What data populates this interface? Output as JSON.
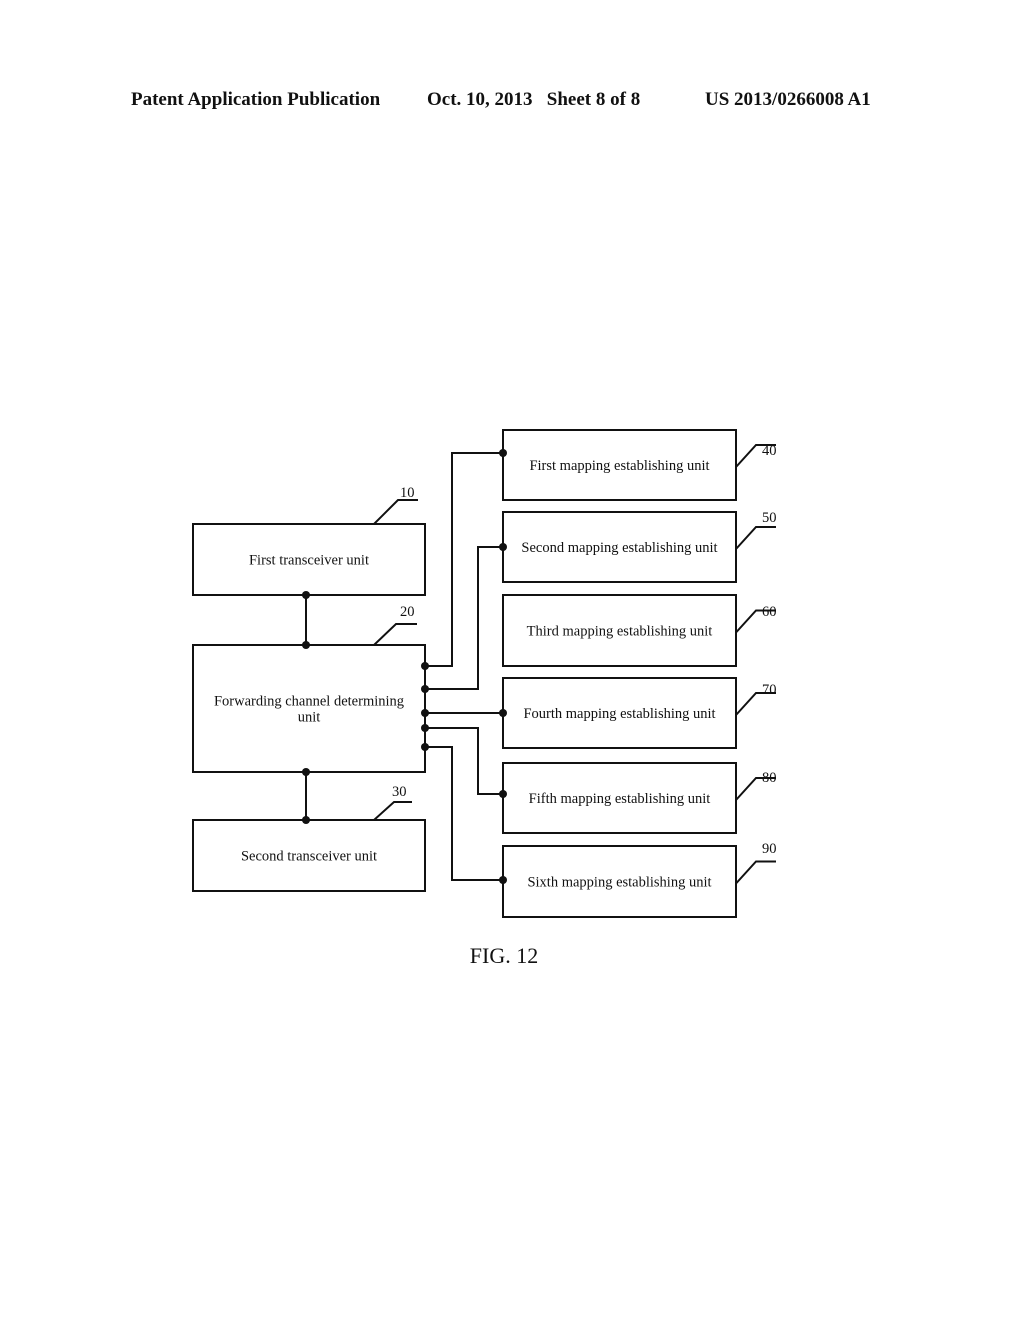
{
  "header": {
    "publication": "Patent Application Publication",
    "date_sheet": "Oct. 10, 2013   Sheet 8 of 8",
    "number": "US 2013/0266008 A1"
  },
  "figure": {
    "caption": "FIG. 12",
    "units": [
      {
        "id": "u10",
        "ref": "10",
        "label": [
          "First transceiver unit"
        ]
      },
      {
        "id": "u20",
        "ref": "20",
        "label": [
          "Forwarding channel determining",
          "unit"
        ]
      },
      {
        "id": "u30",
        "ref": "30",
        "label": [
          "Second transceiver unit"
        ]
      },
      {
        "id": "u40",
        "ref": "40",
        "label": [
          "First mapping establishing unit"
        ]
      },
      {
        "id": "u50",
        "ref": "50",
        "label": [
          "Second mapping establishing unit"
        ]
      },
      {
        "id": "u60",
        "ref": "60",
        "label": [
          "Third mapping establishing unit"
        ]
      },
      {
        "id": "u70",
        "ref": "70",
        "label": [
          "Fourth mapping establishing unit"
        ]
      },
      {
        "id": "u80",
        "ref": "80",
        "label": [
          "Fifth mapping establishing unit"
        ]
      },
      {
        "id": "u90",
        "ref": "90",
        "label": [
          "Sixth mapping establishing unit"
        ]
      }
    ],
    "connections": [
      {
        "from": "u10",
        "to": "u20"
      },
      {
        "from": "u20",
        "to": "u30"
      },
      {
        "from": "u20",
        "to": "u40"
      },
      {
        "from": "u20",
        "to": "u50"
      },
      {
        "from": "u20",
        "to": "u70"
      },
      {
        "from": "u20",
        "to": "u80"
      },
      {
        "from": "u20",
        "to": "u90"
      }
    ]
  }
}
